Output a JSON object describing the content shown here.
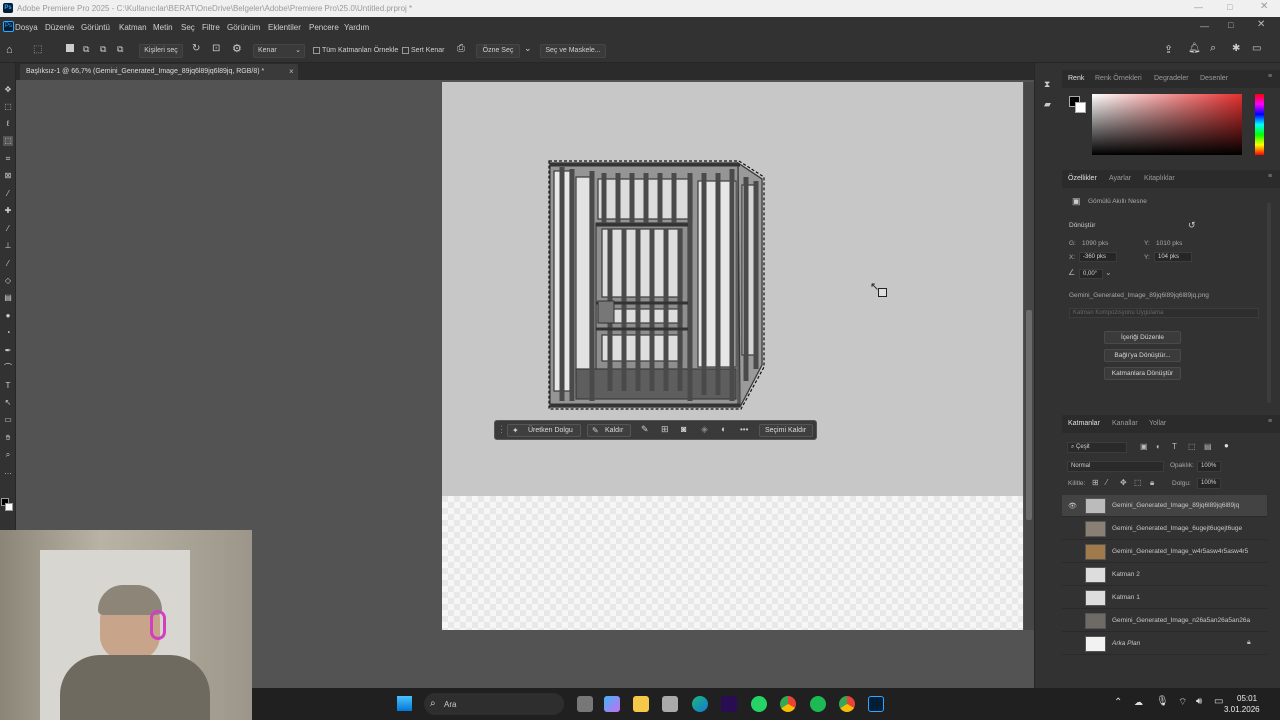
{
  "app": {
    "title": "Adobe Premiere Pro 2025 - C:\\Kullanıcılar\\BERAT\\OneDrive\\Belgeler\\Adobe\\Premiere Pro\\25.0\\Untitled.prproj *",
    "ps_icon": "Ps"
  },
  "menu": [
    "Dosya",
    "Düzenle",
    "Görüntü",
    "Katman",
    "Metin",
    "Seç",
    "Filtre",
    "Görünüm",
    "Eklentiler",
    "Pencere",
    "Yardım"
  ],
  "options": {
    "select_subject": "Kişileri seç",
    "mode": "Kenar",
    "sample_all": "Tüm Katmanları Örnekle",
    "hard_edge": "Sert Kenar",
    "select_subject2": "Özne Seç",
    "select_mask": "Seç ve Maskele..."
  },
  "document": {
    "tab": "Başlıksız-1 @ 66,7% (Gemini_Generated_Image_89jq6l89jq6l89jq, RGB/8) *",
    "close": "×"
  },
  "contextbar": {
    "generative_fill": "Üretken Dolgu",
    "remove": "Kaldır",
    "more": "•••",
    "deselect": "Seçimi Kaldır"
  },
  "color_panel": {
    "tabs": [
      "Renk",
      "Renk Örnekleri",
      "Degradeler",
      "Desenler"
    ],
    "hue_top": "#ff0000"
  },
  "properties": {
    "tabs": [
      "Özellikler",
      "Ayarlar",
      "Kitaplıklar"
    ],
    "object_type": "Gömülü Akıllı Nesne",
    "transform_label": "Dönüştür",
    "w_label": "G:",
    "w_value": "1090 pks",
    "h_label": "Y:",
    "h_value": "1010 pks",
    "x_label": "X:",
    "x_value": "-360 pks",
    "y_label": "Y:",
    "y_value": "104 pks",
    "angle_value": "0,00°",
    "filename": "Gemini_Generated_Image_89jq6l89jq6l89jq.png",
    "comp_placeholder": "Katman Kompozisyonu Uygulama",
    "edit_contents": "İçeriği Düzenle",
    "convert_linked": "Bağlı'ya Dönüştür...",
    "convert_layers": "Katmanlara Dönüştür"
  },
  "layers_panel": {
    "tabs": [
      "Katmanlar",
      "Kanallar",
      "Yollar"
    ],
    "filter": "Çeşit",
    "blend": "Normal",
    "opacity_label": "Opaklık:",
    "opacity": "100%",
    "lock_label": "Kilitle:",
    "fill_label": "Dolgu:",
    "fill": "100%",
    "layers": [
      {
        "name": "Gemini_Generated_Image_89jq6l89jq6l89jq",
        "visible": true,
        "selected": true
      },
      {
        "name": "Gemini_Generated_Image_6ugejt6ugejt6uge",
        "visible": false,
        "selected": false
      },
      {
        "name": "Gemini_Generated_Image_w4r5asw4r5asw4r5",
        "visible": false,
        "selected": false
      },
      {
        "name": "Katman 2",
        "visible": false,
        "selected": false
      },
      {
        "name": "Katman 1",
        "visible": false,
        "selected": false
      },
      {
        "name": "Gemini_Generated_Image_n26a5an26a5an26a",
        "visible": false,
        "selected": false
      },
      {
        "name": "Arka Plan",
        "visible": false,
        "selected": false,
        "locked": true
      }
    ]
  },
  "taskbar": {
    "search": "Ara",
    "time": "05:01",
    "date": "3.01.2026"
  },
  "colors": {
    "accent": "#1473e6",
    "selected_layer": "#434343"
  }
}
